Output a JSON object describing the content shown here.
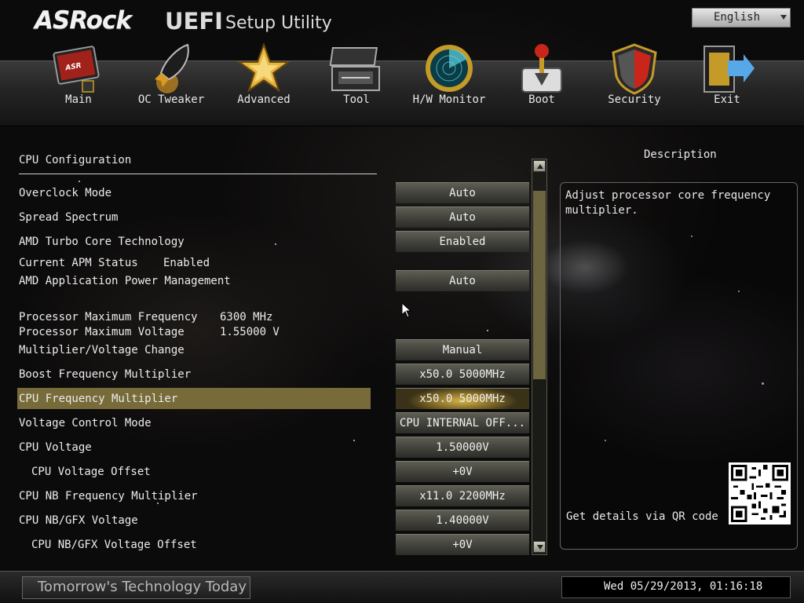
{
  "header": {
    "logo": "ASRock",
    "title_bold": "UEFI",
    "title_rest": "Setup Utility",
    "language": "English"
  },
  "nav": [
    {
      "label": "Main",
      "icon": "monitor-icon"
    },
    {
      "label": "OC Tweaker",
      "icon": "rocket-icon"
    },
    {
      "label": "Advanced",
      "icon": "star-icon"
    },
    {
      "label": "Tool",
      "icon": "toolbox-icon"
    },
    {
      "label": "H/W Monitor",
      "icon": "radar-icon"
    },
    {
      "label": "Boot",
      "icon": "joystick-icon"
    },
    {
      "label": "Security",
      "icon": "shield-icon"
    },
    {
      "label": "Exit",
      "icon": "exit-door-icon"
    }
  ],
  "section_title": "CPU Configuration",
  "settings": {
    "overclock_mode": {
      "label": "Overclock Mode",
      "value": "Auto"
    },
    "spread_spectrum": {
      "label": "Spread Spectrum",
      "value": "Auto"
    },
    "amd_turbo_core": {
      "label": "AMD Turbo Core Technology",
      "value": "Enabled"
    },
    "current_apm_status": {
      "label": "Current APM Status",
      "value": "Enabled"
    },
    "amd_apm": {
      "label": "AMD Application Power Management",
      "value": "Auto"
    },
    "proc_max_freq": {
      "label": "Processor Maximum Frequency",
      "value": "6300 MHz"
    },
    "proc_max_voltage": {
      "label": "Processor Maximum Voltage",
      "value": "1.55000 V"
    },
    "mult_voltage_change": {
      "label": "Multiplier/Voltage Change",
      "value": "Manual"
    },
    "boost_freq_mult": {
      "label": "Boost Frequency Multiplier",
      "value": "x50.0  5000MHz"
    },
    "cpu_freq_mult": {
      "label": "CPU Frequency Multiplier",
      "value": "x50.0  5000MHz"
    },
    "voltage_control_mode": {
      "label": "Voltage Control Mode",
      "value": "CPU INTERNAL OFF..."
    },
    "cpu_voltage": {
      "label": "CPU Voltage",
      "value": "1.50000V"
    },
    "cpu_voltage_offset": {
      "label": "CPU Voltage Offset",
      "value": "+0V"
    },
    "cpu_nb_freq_mult": {
      "label": "CPU NB Frequency Multiplier",
      "value": "x11.0  2200MHz"
    },
    "cpu_nb_gfx_voltage": {
      "label": "CPU NB/GFX Voltage",
      "value": "1.40000V"
    },
    "cpu_nb_gfx_voltage_offset": {
      "label": "CPU NB/GFX Voltage Offset",
      "value": "+0V"
    }
  },
  "description": {
    "title": "Description",
    "text": "Adjust processor core frequency\nmultiplier.",
    "qr_text": "Get details via QR code"
  },
  "footer": {
    "slogan": "Tomorrow's Technology Today",
    "datetime": "Wed 05/29/2013, 01:16:18"
  },
  "colors": {
    "highlight": "#776b3a",
    "scroll_thumb": "#6d6440",
    "active_button": "#d7b44a"
  }
}
